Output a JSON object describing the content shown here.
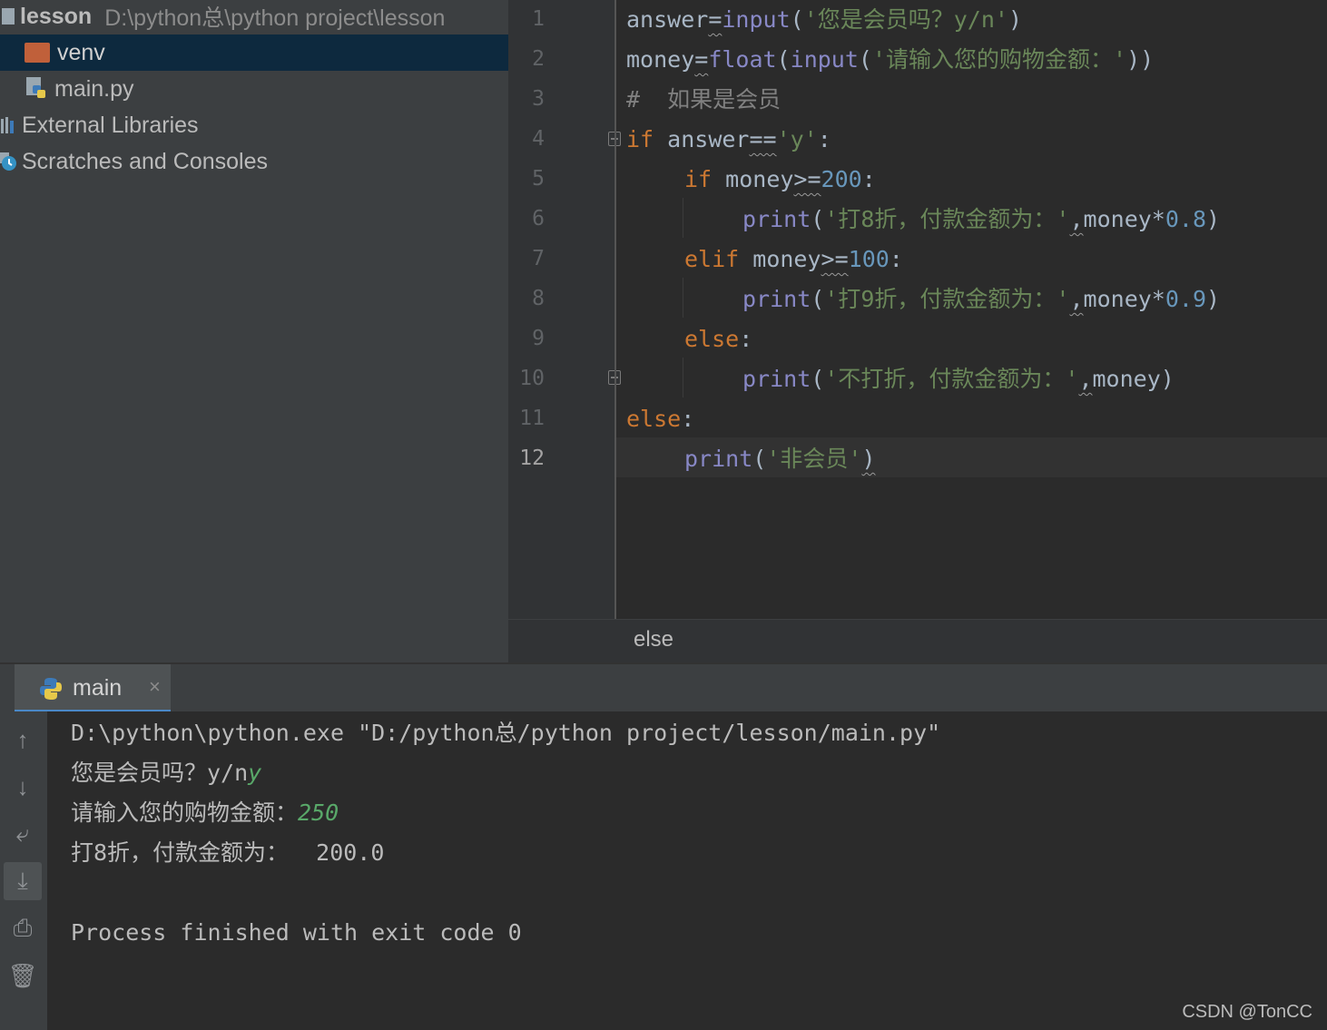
{
  "colors": {
    "keyword": "#cc7832",
    "builtin": "#8888c6",
    "string": "#6a8759",
    "number": "#6897bb",
    "comment": "#808080",
    "user_input": "#59a869",
    "selection": "#0d293e",
    "tab_underline": "#4a88c7"
  },
  "project": {
    "root_name": "lesson",
    "root_path": "D:\\python总\\python project\\lesson",
    "items": [
      {
        "label": "venv",
        "icon": "folder-icon",
        "selected": true
      },
      {
        "label": "main.py",
        "icon": "python-file-icon"
      },
      {
        "label": "External Libraries",
        "icon": "library-icon"
      },
      {
        "label": "Scratches and Consoles",
        "icon": "scratches-icon"
      }
    ]
  },
  "editor": {
    "line_numbers": [
      "1",
      "2",
      "3",
      "4",
      "5",
      "6",
      "7",
      "8",
      "9",
      "10",
      "11",
      "12"
    ],
    "current_line": "12",
    "tokens": {
      "l1": [
        "answer",
        "=",
        "input",
        "(",
        "'您是会员吗？y/n'",
        ")"
      ],
      "l2": [
        "money",
        "=",
        "float",
        "(",
        "input",
        "(",
        "'请输入您的购物金额：'",
        "))"
      ],
      "l3": [
        "#  如果是会员"
      ],
      "l4": [
        "if",
        " answer",
        "==",
        "'y'",
        ":"
      ],
      "l5": [
        "if",
        " money",
        ">=",
        "200",
        ":"
      ],
      "l6": [
        "print",
        "(",
        "'打8折，付款金额为：'",
        ",",
        "money*",
        "0.8",
        ")"
      ],
      "l7": [
        "elif",
        " money",
        ">=",
        "100",
        ":"
      ],
      "l8": [
        "print",
        "(",
        "'打9折，付款金额为：'",
        ",",
        "money*",
        "0.9",
        ")"
      ],
      "l9": [
        "else",
        ":"
      ],
      "l10": [
        "print",
        "(",
        "'不打折，付款金额为：'",
        ",",
        "money)"
      ],
      "l11": [
        "else",
        ":"
      ],
      "l12": [
        "print",
        "(",
        "'非会员'",
        ")"
      ]
    }
  },
  "breadcrumb": "else",
  "run": {
    "tab_label": "main",
    "tab_close": "×",
    "console": {
      "line1": "D:\\python\\python.exe \"D:/python总/python project/lesson/main.py\"",
      "line2_prompt": "您是会员吗？y/n",
      "line2_input": "y",
      "line3_prompt": "请输入您的购物金额：",
      "line3_input": "250",
      "line4": "打8折，付款金额为：  200.0",
      "line6": "Process finished with exit code 0"
    },
    "toolbar": [
      {
        "icon": "up-arrow-icon",
        "glyph": "↑"
      },
      {
        "icon": "down-arrow-icon",
        "glyph": "↓"
      },
      {
        "icon": "soft-wrap-icon",
        "glyph": "⤶"
      },
      {
        "icon": "scroll-to-end-icon",
        "glyph": "⤓"
      },
      {
        "icon": "print-icon",
        "glyph": "⎙"
      },
      {
        "icon": "trash-icon",
        "glyph": "🗑"
      }
    ]
  },
  "watermark": "CSDN @TonCC"
}
